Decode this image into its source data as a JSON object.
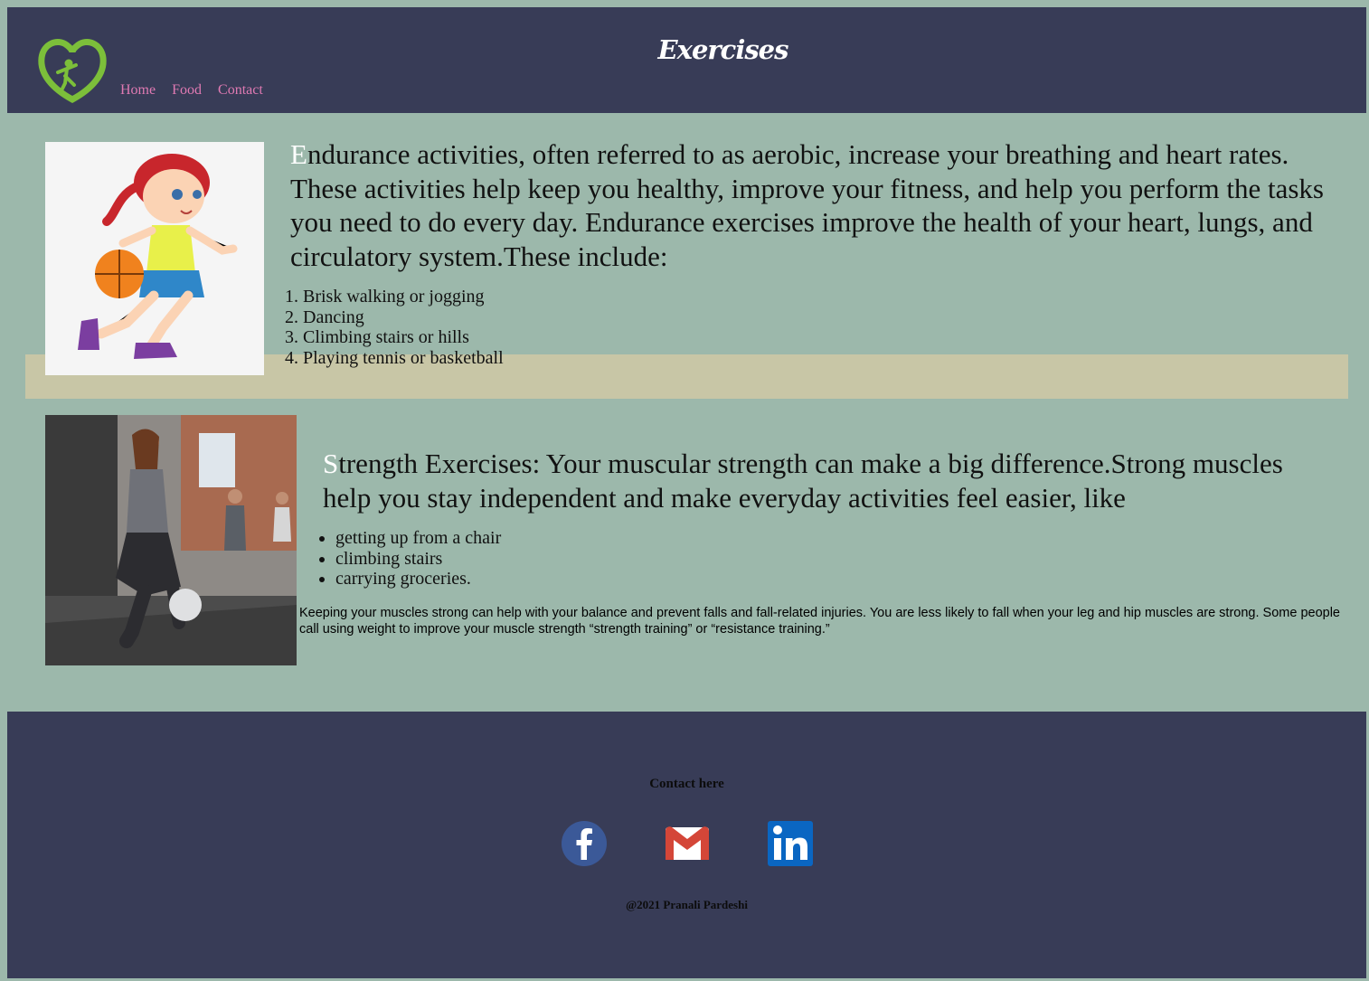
{
  "header": {
    "title": "Exercises",
    "nav": [
      "Home",
      "Food",
      "Contact"
    ],
    "logo_icon": "heart-logo-icon"
  },
  "section1": {
    "dropcap": "E",
    "text": "ndurance activities, often referred to as aerobic, increase your breathing and heart rates. These activities help keep you healthy, improve your fitness, and help you perform the tasks you need to do every day. Endurance exercises improve the health of your heart, lungs, and circulatory system.These include:",
    "items": [
      "Brisk walking or jogging",
      "Dancing",
      "Climbing stairs or hills",
      "Playing tennis or basketball"
    ],
    "image_icon": "girl-basketball-illustration"
  },
  "section2": {
    "dropcap": "S",
    "text": "trength Exercises: Your muscular strength can make a big difference.Strong muscles help you stay independent and make everyday activities feel easier, like",
    "items": [
      "getting up from a chair",
      "climbing stairs",
      "carrying groceries."
    ],
    "note": "Keeping your muscles strong can help with your balance and prevent falls and fall-related injuries. You are less likely to fall when your leg and hip muscles are strong. Some people call using weight to improve your muscle strength “strength training” or “resistance training.”",
    "image_icon": "gym-lunges-photo"
  },
  "footer": {
    "contact_title": "Contact here",
    "copyright": "@2021 Pranali Pardeshi",
    "social": [
      "facebook-icon",
      "gmail-icon",
      "linkedin-icon"
    ]
  },
  "colors": {
    "background": "#9cb8ab",
    "header": "#383c57",
    "band": "#c8c6a6",
    "nav_link": "#e07ab3"
  }
}
